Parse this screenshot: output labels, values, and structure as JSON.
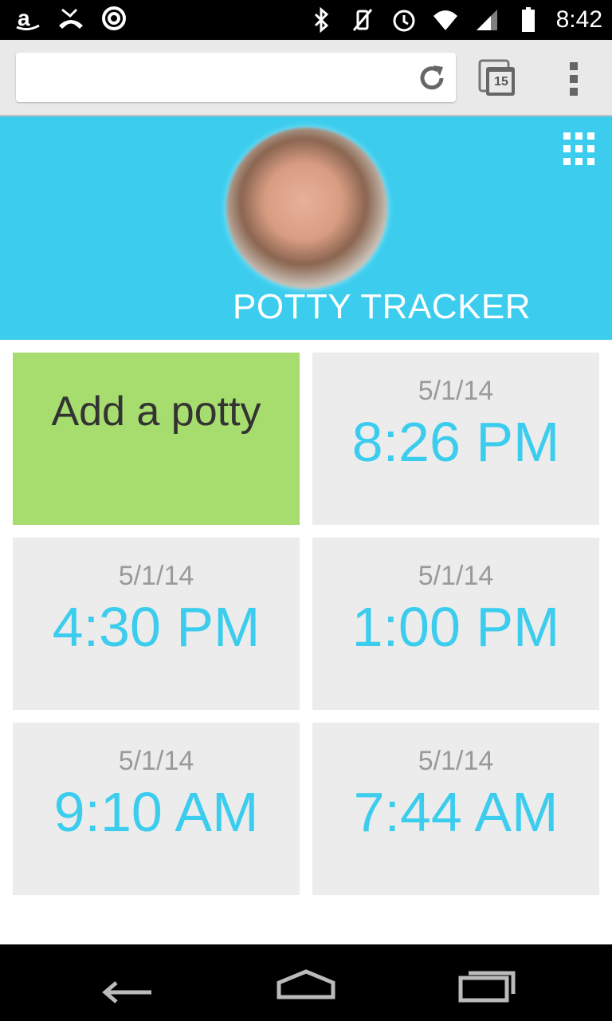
{
  "status_bar": {
    "time": "8:42",
    "left_icons": [
      "amazon-icon",
      "missed-call-icon",
      "sync-icon"
    ],
    "right_icons": [
      "bluetooth-icon",
      "vibrate-off-icon",
      "alarm-icon",
      "wifi-icon",
      "signal-icon",
      "battery-icon"
    ]
  },
  "browser": {
    "url": "",
    "tab_count": "15"
  },
  "header": {
    "title": "POTTY TRACKER",
    "background_color": "#3ccdee"
  },
  "tiles": {
    "add_label": "Add a potty",
    "entries": [
      {
        "date": "5/1/14",
        "time": "8:26 PM"
      },
      {
        "date": "5/1/14",
        "time": "4:30 PM"
      },
      {
        "date": "5/1/14",
        "time": "1:00 PM"
      },
      {
        "date": "5/1/14",
        "time": "9:10 AM"
      },
      {
        "date": "5/1/14",
        "time": "7:44 AM"
      }
    ],
    "add_color": "#a6dd6e",
    "time_color": "#3ccdee"
  },
  "nav_bar": {
    "buttons": [
      "back-icon",
      "home-icon",
      "recent-apps-icon"
    ]
  }
}
